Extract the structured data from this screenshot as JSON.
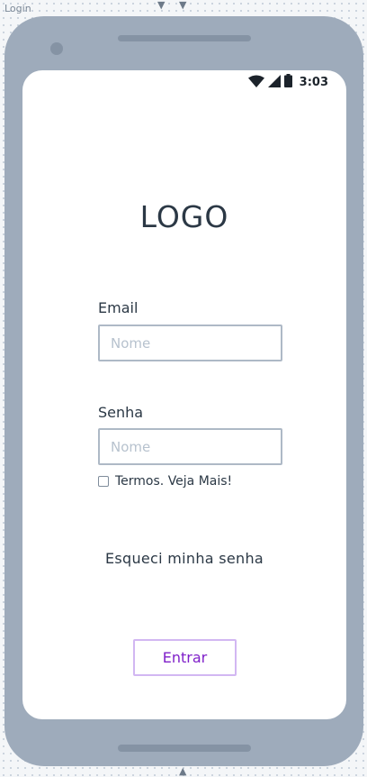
{
  "frame": {
    "label": "Login"
  },
  "status_bar": {
    "time": "3:03",
    "icons": [
      "wifi-icon",
      "signal-icon",
      "battery-icon"
    ]
  },
  "login": {
    "logo": "LOGO",
    "email": {
      "label": "Email",
      "placeholder": "Nome",
      "value": ""
    },
    "password": {
      "label": "Senha",
      "placeholder": "Nome",
      "value": ""
    },
    "terms": {
      "label": "Termos. Veja Mais!",
      "checked": false
    },
    "forgot_password": "Esqueci minha senha",
    "submit_label": "Entrar"
  },
  "colors": {
    "accent": "#7f1fc9",
    "device": "#9eabbb",
    "text": "#2b3845"
  }
}
